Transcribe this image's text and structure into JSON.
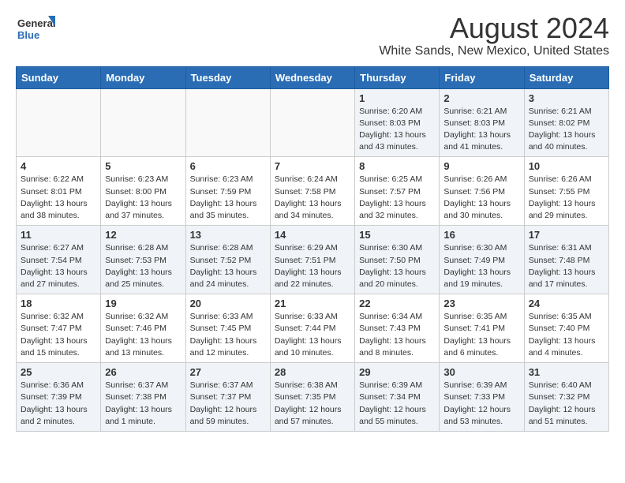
{
  "logo": {
    "general": "General",
    "blue": "Blue"
  },
  "title": "August 2024",
  "location": "White Sands, New Mexico, United States",
  "days_of_week": [
    "Sunday",
    "Monday",
    "Tuesday",
    "Wednesday",
    "Thursday",
    "Friday",
    "Saturday"
  ],
  "weeks": [
    [
      {
        "day": "",
        "info": ""
      },
      {
        "day": "",
        "info": ""
      },
      {
        "day": "",
        "info": ""
      },
      {
        "day": "",
        "info": ""
      },
      {
        "day": "1",
        "info": "Sunrise: 6:20 AM\nSunset: 8:03 PM\nDaylight: 13 hours\nand 43 minutes."
      },
      {
        "day": "2",
        "info": "Sunrise: 6:21 AM\nSunset: 8:03 PM\nDaylight: 13 hours\nand 41 minutes."
      },
      {
        "day": "3",
        "info": "Sunrise: 6:21 AM\nSunset: 8:02 PM\nDaylight: 13 hours\nand 40 minutes."
      }
    ],
    [
      {
        "day": "4",
        "info": "Sunrise: 6:22 AM\nSunset: 8:01 PM\nDaylight: 13 hours\nand 38 minutes."
      },
      {
        "day": "5",
        "info": "Sunrise: 6:23 AM\nSunset: 8:00 PM\nDaylight: 13 hours\nand 37 minutes."
      },
      {
        "day": "6",
        "info": "Sunrise: 6:23 AM\nSunset: 7:59 PM\nDaylight: 13 hours\nand 35 minutes."
      },
      {
        "day": "7",
        "info": "Sunrise: 6:24 AM\nSunset: 7:58 PM\nDaylight: 13 hours\nand 34 minutes."
      },
      {
        "day": "8",
        "info": "Sunrise: 6:25 AM\nSunset: 7:57 PM\nDaylight: 13 hours\nand 32 minutes."
      },
      {
        "day": "9",
        "info": "Sunrise: 6:26 AM\nSunset: 7:56 PM\nDaylight: 13 hours\nand 30 minutes."
      },
      {
        "day": "10",
        "info": "Sunrise: 6:26 AM\nSunset: 7:55 PM\nDaylight: 13 hours\nand 29 minutes."
      }
    ],
    [
      {
        "day": "11",
        "info": "Sunrise: 6:27 AM\nSunset: 7:54 PM\nDaylight: 13 hours\nand 27 minutes."
      },
      {
        "day": "12",
        "info": "Sunrise: 6:28 AM\nSunset: 7:53 PM\nDaylight: 13 hours\nand 25 minutes."
      },
      {
        "day": "13",
        "info": "Sunrise: 6:28 AM\nSunset: 7:52 PM\nDaylight: 13 hours\nand 24 minutes."
      },
      {
        "day": "14",
        "info": "Sunrise: 6:29 AM\nSunset: 7:51 PM\nDaylight: 13 hours\nand 22 minutes."
      },
      {
        "day": "15",
        "info": "Sunrise: 6:30 AM\nSunset: 7:50 PM\nDaylight: 13 hours\nand 20 minutes."
      },
      {
        "day": "16",
        "info": "Sunrise: 6:30 AM\nSunset: 7:49 PM\nDaylight: 13 hours\nand 19 minutes."
      },
      {
        "day": "17",
        "info": "Sunrise: 6:31 AM\nSunset: 7:48 PM\nDaylight: 13 hours\nand 17 minutes."
      }
    ],
    [
      {
        "day": "18",
        "info": "Sunrise: 6:32 AM\nSunset: 7:47 PM\nDaylight: 13 hours\nand 15 minutes."
      },
      {
        "day": "19",
        "info": "Sunrise: 6:32 AM\nSunset: 7:46 PM\nDaylight: 13 hours\nand 13 minutes."
      },
      {
        "day": "20",
        "info": "Sunrise: 6:33 AM\nSunset: 7:45 PM\nDaylight: 13 hours\nand 12 minutes."
      },
      {
        "day": "21",
        "info": "Sunrise: 6:33 AM\nSunset: 7:44 PM\nDaylight: 13 hours\nand 10 minutes."
      },
      {
        "day": "22",
        "info": "Sunrise: 6:34 AM\nSunset: 7:43 PM\nDaylight: 13 hours\nand 8 minutes."
      },
      {
        "day": "23",
        "info": "Sunrise: 6:35 AM\nSunset: 7:41 PM\nDaylight: 13 hours\nand 6 minutes."
      },
      {
        "day": "24",
        "info": "Sunrise: 6:35 AM\nSunset: 7:40 PM\nDaylight: 13 hours\nand 4 minutes."
      }
    ],
    [
      {
        "day": "25",
        "info": "Sunrise: 6:36 AM\nSunset: 7:39 PM\nDaylight: 13 hours\nand 2 minutes."
      },
      {
        "day": "26",
        "info": "Sunrise: 6:37 AM\nSunset: 7:38 PM\nDaylight: 13 hours\nand 1 minute."
      },
      {
        "day": "27",
        "info": "Sunrise: 6:37 AM\nSunset: 7:37 PM\nDaylight: 12 hours\nand 59 minutes."
      },
      {
        "day": "28",
        "info": "Sunrise: 6:38 AM\nSunset: 7:35 PM\nDaylight: 12 hours\nand 57 minutes."
      },
      {
        "day": "29",
        "info": "Sunrise: 6:39 AM\nSunset: 7:34 PM\nDaylight: 12 hours\nand 55 minutes."
      },
      {
        "day": "30",
        "info": "Sunrise: 6:39 AM\nSunset: 7:33 PM\nDaylight: 12 hours\nand 53 minutes."
      },
      {
        "day": "31",
        "info": "Sunrise: 6:40 AM\nSunset: 7:32 PM\nDaylight: 12 hours\nand 51 minutes."
      }
    ]
  ]
}
